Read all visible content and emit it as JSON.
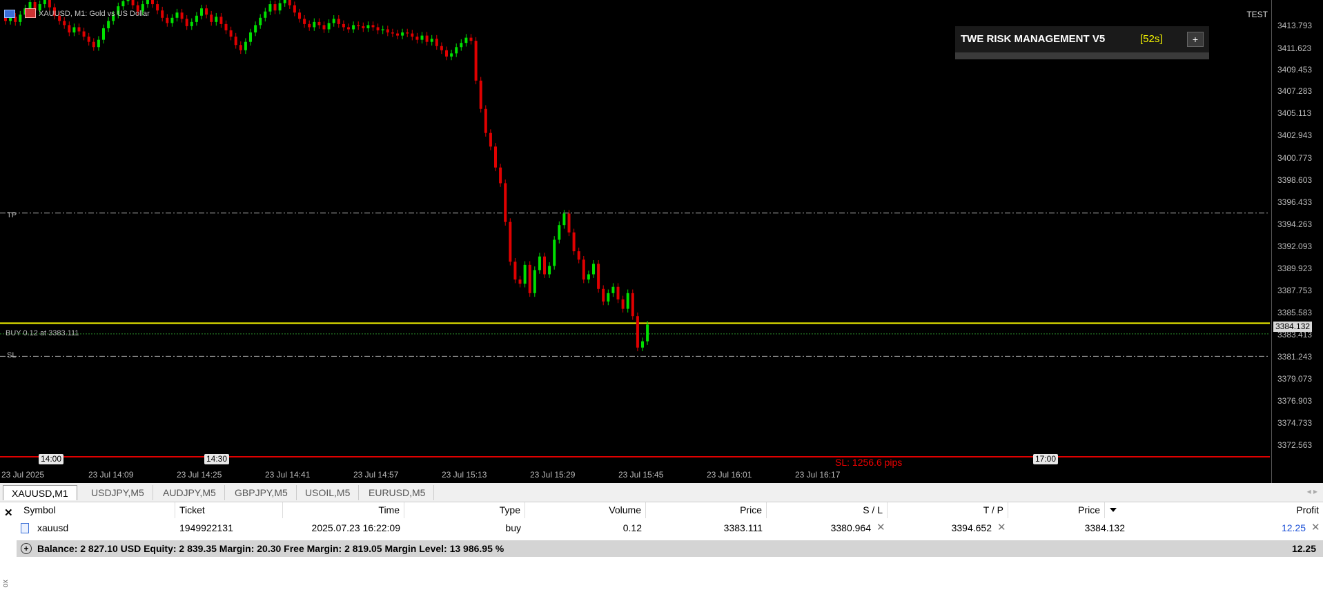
{
  "chart": {
    "title": "XAUUSD, M1:  Gold vs US Dollar",
    "account_label": "TEST",
    "tp_label": "TP",
    "sl_label": "SL",
    "buy_label": "BUY 0.12 at 3383.111",
    "sl_pips": "SL: 1256.6 pips",
    "current_price": "3384.132",
    "price_ticks": [
      "3413.793",
      "3411.623",
      "3409.453",
      "3407.283",
      "3405.113",
      "3402.943",
      "3400.773",
      "3398.603",
      "3396.433",
      "3394.263",
      "3392.093",
      "3389.923",
      "3387.753",
      "3385.583",
      "3383.413",
      "3381.243",
      "3379.073",
      "3376.903",
      "3374.733",
      "3372.563"
    ],
    "time_labels": [
      "23 Jul 2025",
      "23 Jul 14:09",
      "23 Jul 14:25",
      "23 Jul 14:41",
      "23 Jul 14:57",
      "23 Jul 15:13",
      "23 Jul 15:29",
      "23 Jul 15:45",
      "23 Jul 16:01",
      "23 Jul 16:17"
    ],
    "time_badges": [
      "14:00",
      "14:30",
      "17:00"
    ],
    "colors": {
      "bull": "#00e000",
      "bear": "#e00000",
      "entry": "#f5f500",
      "sl_line": "#e00000"
    }
  },
  "risk_panel": {
    "title": "TWE RISK MANAGEMENT V5",
    "timer": "[52s]",
    "button": "+"
  },
  "tabs": [
    "XAUUSD,M1",
    "USDJPY,M5",
    "AUDJPY,M5",
    "GBPJPY,M5",
    "USOIL,M5",
    "EURUSD,M5"
  ],
  "tab_scroll": "◂ ▸",
  "terminal": {
    "columns": [
      "Symbol",
      "Ticket",
      "Time",
      "Type",
      "Volume",
      "Price",
      "S / L",
      "T / P",
      "Price",
      "Profit"
    ],
    "row": {
      "symbol": "xauusd",
      "ticket": "1949922131",
      "time": "2025.07.23 16:22:09",
      "type": "buy",
      "volume": "0.12",
      "price": "3383.111",
      "sl": "3380.964",
      "tp": "3394.652",
      "current": "3384.132",
      "profit": "12.25"
    },
    "balance_text": "Balance: 2 827.10 USD  Equity: 2 839.35  Margin: 20.30  Free Margin: 2 819.05  Margin Level: 13 986.95 %",
    "balance_profit": "12.25",
    "side_label": "ox"
  },
  "chart_data": {
    "type": "candlestick",
    "title": "XAUUSD, M1:  Gold vs US Dollar",
    "ylim": [
      3371.5,
      3415.0
    ],
    "levels": {
      "tp": 3394.652,
      "entry": 3383.111,
      "sl": 3380.964,
      "current": 3384.132
    },
    "closes": [
      3413.0,
      3413.4,
      3412.9,
      3413.6,
      3414.2,
      3414.8,
      3414.0,
      3414.6,
      3415.0,
      3414.3,
      3413.5,
      3413.0,
      3412.6,
      3411.9,
      3412.4,
      3412.0,
      3411.5,
      3411.0,
      3410.5,
      3411.2,
      3412.3,
      3413.0,
      3413.6,
      3414.4,
      3414.9,
      3415.0,
      3414.5,
      3413.9,
      3414.6,
      3415.0,
      3414.6,
      3414.0,
      3413.3,
      3412.8,
      3413.3,
      3413.8,
      3413.2,
      3412.5,
      3412.9,
      3413.5,
      3414.2,
      3413.6,
      3412.9,
      3413.4,
      3412.7,
      3412.1,
      3411.5,
      3410.7,
      3410.2,
      3411.0,
      3411.9,
      3412.6,
      3413.3,
      3413.9,
      3414.6,
      3414.0,
      3414.7,
      3415.0,
      3414.5,
      3413.8,
      3413.2,
      3412.7,
      3412.4,
      3412.9,
      3412.6,
      3412.2,
      3412.8,
      3413.2,
      3412.7,
      3412.4,
      3412.2,
      3412.6,
      3412.5,
      3412.3,
      3412.6,
      3412.4,
      3412.1,
      3412.2,
      3411.9,
      3411.8,
      3411.6,
      3411.9,
      3411.8,
      3411.5,
      3411.2,
      3411.6,
      3411.0,
      3411.3,
      3410.6,
      3410.2,
      3409.6,
      3409.9,
      3410.5,
      3410.9,
      3411.4,
      3411.1,
      3407.3,
      3404.6,
      3402.3,
      3401.0,
      3399.0,
      3397.5,
      3393.8,
      3390.0,
      3388.3,
      3387.9,
      3389.7,
      3387.0,
      3389.2,
      3390.5,
      3388.8,
      3389.6,
      3392.1,
      3393.5,
      3394.6,
      3392.8,
      3391.0,
      3390.2,
      3388.3,
      3388.8,
      3389.8,
      3387.4,
      3386.2,
      3387.0,
      3387.6,
      3386.4,
      3385.5,
      3387.0,
      3384.8,
      3381.8,
      3382.4,
      3384.0
    ]
  }
}
